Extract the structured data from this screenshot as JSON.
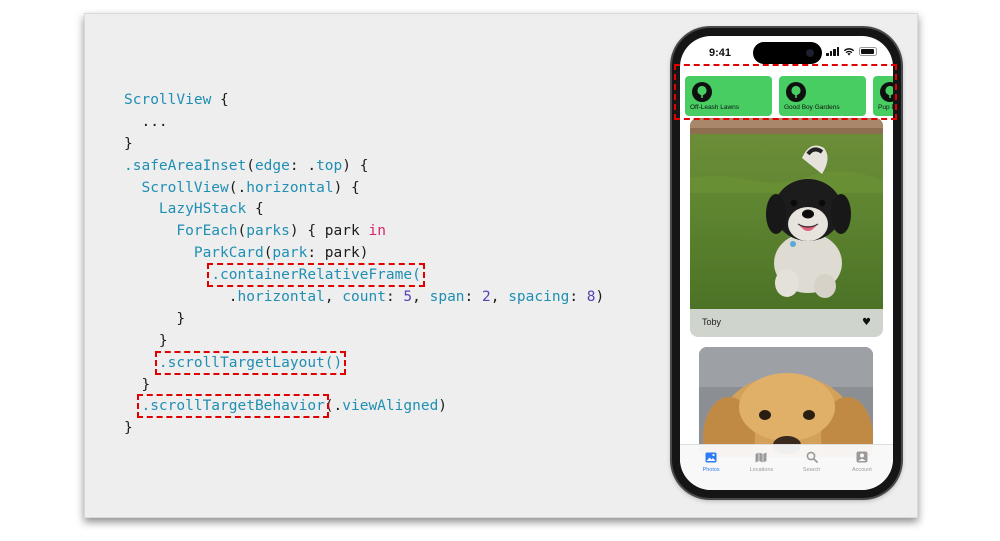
{
  "code_lines": [
    [
      {
        "t": "ScrollView",
        "c": "blue"
      },
      {
        "t": " {",
        "c": "dark"
      }
    ],
    [
      {
        "t": "  ...",
        "c": "dark"
      }
    ],
    [
      {
        "t": "}",
        "c": "dark"
      }
    ],
    [
      {
        "t": ".safeAreaInset",
        "c": "blue"
      },
      {
        "t": "(",
        "c": "dark"
      },
      {
        "t": "edge",
        "c": "blue"
      },
      {
        "t": ": .",
        "c": "dark"
      },
      {
        "t": "top",
        "c": "blue"
      },
      {
        "t": ") {",
        "c": "dark"
      }
    ],
    [
      {
        "t": "  ",
        "c": "dark"
      },
      {
        "t": "ScrollView",
        "c": "blue"
      },
      {
        "t": "(.",
        "c": "dark"
      },
      {
        "t": "horizontal",
        "c": "blue"
      },
      {
        "t": ") {",
        "c": "dark"
      }
    ],
    [
      {
        "t": "    ",
        "c": "dark"
      },
      {
        "t": "LazyHStack",
        "c": "blue"
      },
      {
        "t": " {",
        "c": "dark"
      }
    ],
    [
      {
        "t": "      ",
        "c": "dark"
      },
      {
        "t": "ForEach",
        "c": "blue"
      },
      {
        "t": "(",
        "c": "dark"
      },
      {
        "t": "parks",
        "c": "blue"
      },
      {
        "t": ") { park ",
        "c": "dark"
      },
      {
        "t": "in",
        "c": "pink"
      }
    ],
    [
      {
        "t": "        ",
        "c": "dark"
      },
      {
        "t": "ParkCard",
        "c": "blue"
      },
      {
        "t": "(",
        "c": "dark"
      },
      {
        "t": "park",
        "c": "blue"
      },
      {
        "t": ": park)",
        "c": "dark"
      }
    ],
    [
      {
        "t": "          ",
        "c": "dark"
      },
      {
        "t": ".containerRelativeFrame(",
        "c": "blue",
        "hl": true
      }
    ],
    [
      {
        "t": "            .",
        "c": "dark"
      },
      {
        "t": "horizontal",
        "c": "blue"
      },
      {
        "t": ", ",
        "c": "dark"
      },
      {
        "t": "count",
        "c": "blue"
      },
      {
        "t": ": ",
        "c": "dark"
      },
      {
        "t": "5",
        "c": "purple"
      },
      {
        "t": ", ",
        "c": "dark"
      },
      {
        "t": "span",
        "c": "blue"
      },
      {
        "t": ": ",
        "c": "dark"
      },
      {
        "t": "2",
        "c": "purple"
      },
      {
        "t": ", ",
        "c": "dark"
      },
      {
        "t": "spacing",
        "c": "blue"
      },
      {
        "t": ": ",
        "c": "dark"
      },
      {
        "t": "8",
        "c": "purple"
      },
      {
        "t": ")",
        "c": "dark"
      }
    ],
    [
      {
        "t": "      }",
        "c": "dark"
      }
    ],
    [
      {
        "t": "    }",
        "c": "dark"
      }
    ],
    [
      {
        "t": "    ",
        "c": "dark"
      },
      {
        "t": ".scrollTargetLayout()",
        "c": "blue",
        "hl": true
      }
    ],
    [
      {
        "t": "  }",
        "c": "dark"
      }
    ],
    [
      {
        "t": "  ",
        "c": "dark"
      },
      {
        "t": ".scrollTargetBehavior",
        "c": "blue",
        "hl": true
      },
      {
        "t": "(.",
        "c": "dark"
      },
      {
        "t": "viewAligned",
        "c": "blue"
      },
      {
        "t": ")",
        "c": "dark"
      }
    ],
    [
      {
        "t": "}",
        "c": "dark"
      }
    ]
  ],
  "colors": {
    "keyword_blue": "#1f8fb3",
    "keyword_pink": "#d6246b",
    "number_purple": "#5b3fb6",
    "highlight_red": "#e00000",
    "park_card_green": "#48cd63",
    "tab_active_blue": "#2f7bf6"
  },
  "phone": {
    "status_time": "9:41",
    "park_cards": [
      {
        "label": "Off-Leash Lawns",
        "icon": "tree-icon"
      },
      {
        "label": "Good Boy Gardens",
        "icon": "tree-icon"
      },
      {
        "label": "Pup Playgro",
        "icon": "tree-icon"
      }
    ],
    "photo_card": {
      "name": "Toby",
      "icon": "heart-icon"
    },
    "tabs": [
      {
        "label": "Photos",
        "icon": "photos-icon",
        "active": true
      },
      {
        "label": "Locations",
        "icon": "map-icon",
        "active": false
      },
      {
        "label": "Search",
        "icon": "search-icon",
        "active": false
      },
      {
        "label": "Account",
        "icon": "account-icon",
        "active": false
      }
    ]
  }
}
